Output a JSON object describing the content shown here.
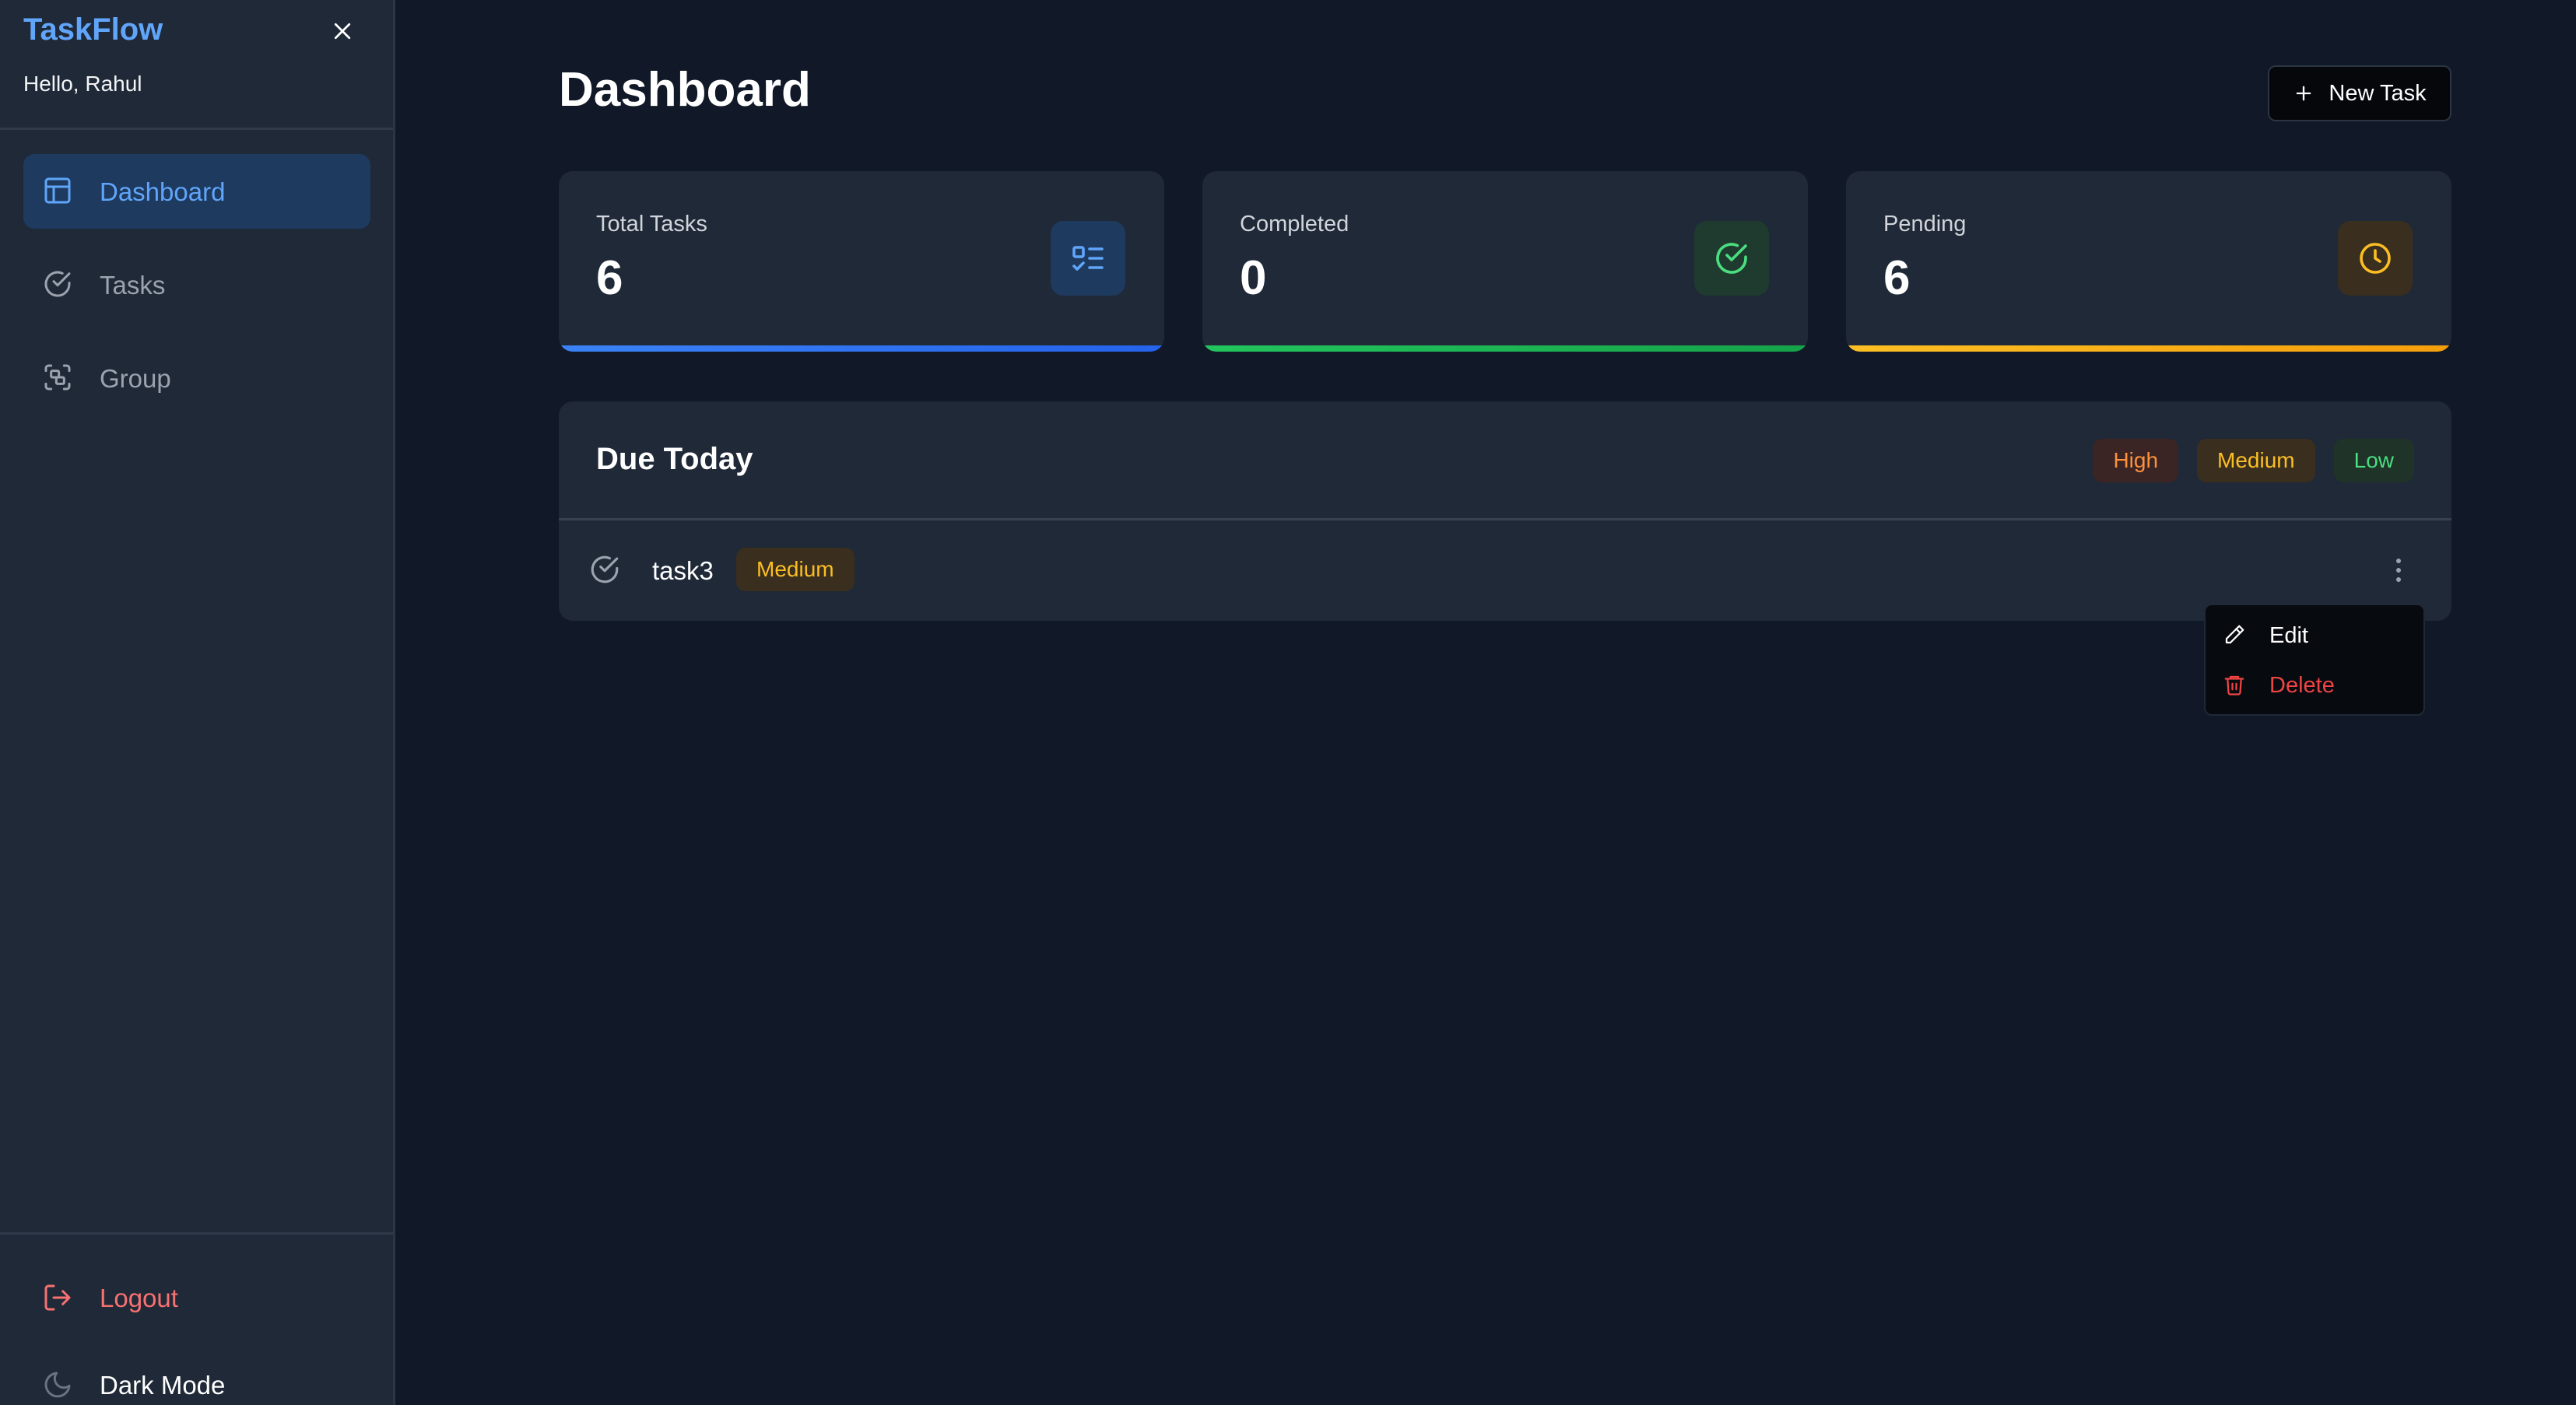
{
  "app": {
    "brand": "TaskFlow",
    "greeting": "Hello, Rahul"
  },
  "sidebar": {
    "items": [
      {
        "label": "Dashboard",
        "icon": "layout-icon",
        "active": true
      },
      {
        "label": "Tasks",
        "icon": "circle-check-icon",
        "active": false
      },
      {
        "label": "Group",
        "icon": "scan-group-icon",
        "active": false
      }
    ],
    "logout_label": "Logout",
    "dark_mode_label": "Dark Mode"
  },
  "header": {
    "title": "Dashboard",
    "new_task_label": "New Task"
  },
  "stats": [
    {
      "label": "Total Tasks",
      "value": "6",
      "icon": "list-check-icon",
      "color": "#3b82f6"
    },
    {
      "label": "Completed",
      "value": "0",
      "icon": "circle-check-icon",
      "color": "#22c55e"
    },
    {
      "label": "Pending",
      "value": "6",
      "icon": "clock-icon",
      "color": "#f59e0b"
    }
  ],
  "due_today": {
    "title": "Due Today",
    "legend": [
      "High",
      "Medium",
      "Low"
    ],
    "tasks": [
      {
        "name": "task3",
        "priority": "Medium"
      }
    ]
  },
  "context_menu": {
    "edit_label": "Edit",
    "delete_label": "Delete"
  },
  "colors": {
    "accent": "#60a5fa",
    "danger": "#ef4444",
    "background": "#111827",
    "surface": "#1f2937",
    "high": "#fb923c",
    "medium": "#fbbf24",
    "low": "#4ade80"
  }
}
